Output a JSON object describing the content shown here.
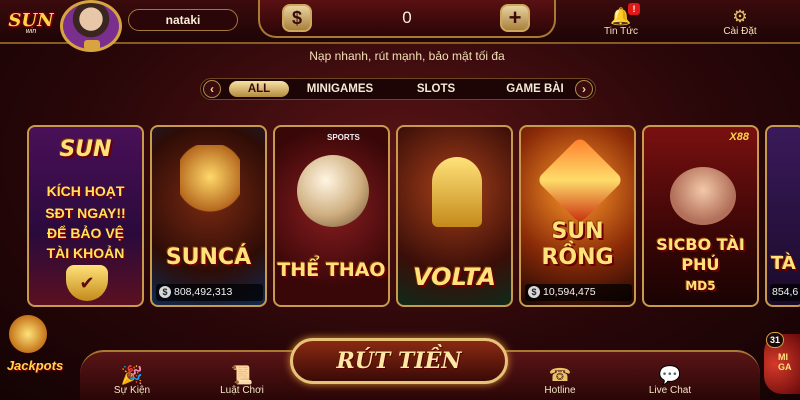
{
  "brand": {
    "logo_text": "SUN",
    "logo_sub": "win"
  },
  "user": {
    "username": "nataki"
  },
  "balance": {
    "currency_symbol": "$",
    "value": "0",
    "add_symbol": "+"
  },
  "tagline": "Nạp nhanh, rút mạnh, bảo mật tối đa",
  "top_actions": [
    {
      "label": "Tin Tức",
      "icon": "bell-icon",
      "glyph": "🔔",
      "badge": "!"
    },
    {
      "label": "Cài Đặt",
      "icon": "gear-icon",
      "glyph": "⚙"
    }
  ],
  "tabs": {
    "prev_arrow": "‹",
    "next_arrow": "›",
    "items": [
      {
        "label": "ALL",
        "active": true
      },
      {
        "label": "MINIGAMES",
        "active": false
      },
      {
        "label": "SLOTS",
        "active": false
      },
      {
        "label": "GAME BÀI",
        "active": false
      }
    ]
  },
  "promo": {
    "logo": "SUN",
    "lines": [
      "KÍCH HOẠT",
      "SĐT NGAY!!",
      "ĐỂ BẢO VỆ",
      "TÀI KHOẢN"
    ]
  },
  "games": [
    {
      "title": "SUNCÁ",
      "jackpot": "808,492,313"
    },
    {
      "title": "THỂ THAO",
      "tag": "SPORTS"
    },
    {
      "title": "VOLTA"
    },
    {
      "title": "SUN RỒNG",
      "jackpot": "10,594,475"
    },
    {
      "title": "SICBO TÀI PHÚ",
      "subtitle": "MD5",
      "badge": "X88"
    },
    {
      "title": "TÀ",
      "jackpot": "854,6"
    }
  ],
  "jackpot_coin_symbol": "$",
  "bottom_nav": [
    {
      "label": "Sự Kiện",
      "icon": "party-popper-icon",
      "glyph": "🎉"
    },
    {
      "label": "Luật Chơi",
      "icon": "rules-book-icon",
      "glyph": "📜"
    },
    {
      "label": "Hotline",
      "icon": "phone-icon",
      "glyph": "☎"
    },
    {
      "label": "Live Chat",
      "icon": "chat-icon",
      "glyph": "💬"
    }
  ],
  "withdraw_label": "RÚT TIỀN",
  "jackpots_label": "Jackpots",
  "mini_game": {
    "count": "31",
    "label": "MI GA"
  }
}
